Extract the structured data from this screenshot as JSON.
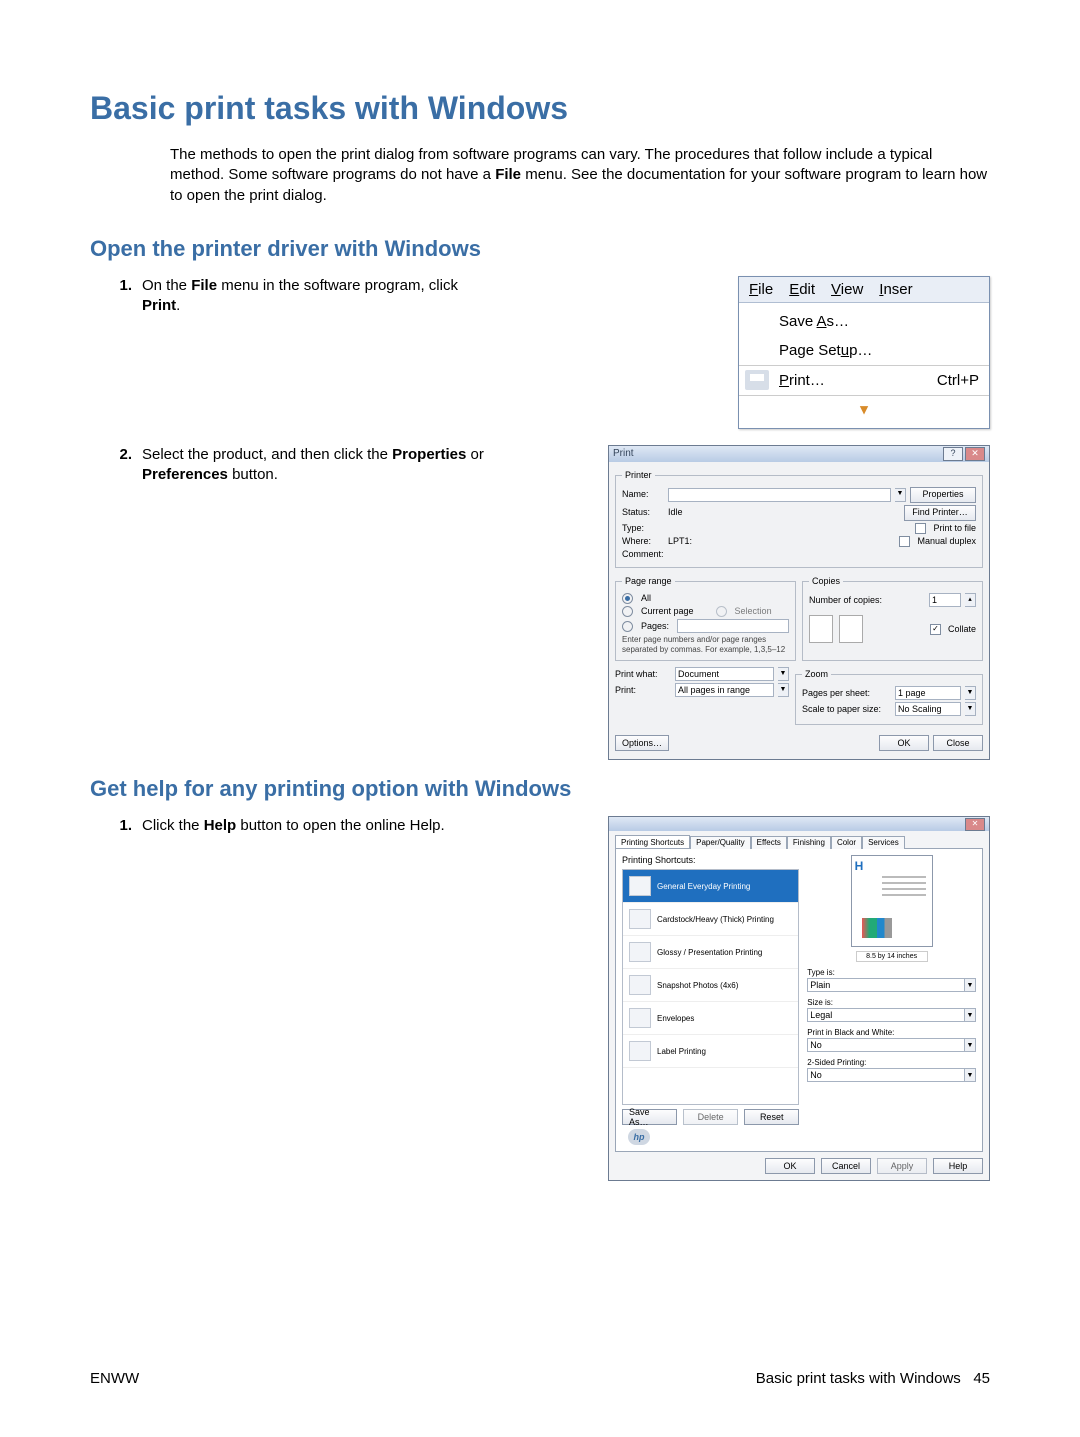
{
  "headings": {
    "h1": "Basic print tasks with Windows",
    "h2a": "Open the printer driver with Windows",
    "h2b": "Get help for any printing option with Windows"
  },
  "intro": "The methods to open the print dialog from software programs can vary. The procedures that follow include a typical method. Some software programs do not have a ",
  "intro_bold": "File",
  "intro_after": " menu. See the documentation for your software program to learn how to open the print dialog.",
  "steps": {
    "a1_pre": "On the ",
    "a1_b1": "File",
    "a1_mid": " menu in the software program, click ",
    "a1_b2": "Print",
    "a1_post": ".",
    "a2_pre": "Select the product, and then click the ",
    "a2_b1": "Properties",
    "a2_or": " or ",
    "a2_b2": "Preferences",
    "a2_post": " button.",
    "b1_pre": "Click the ",
    "b1_b1": "Help",
    "b1_post": " button to open the online Help."
  },
  "menu": {
    "file": "File",
    "edit": "Edit",
    "view": "View",
    "insert": "Inser",
    "save_as": "Save As…",
    "page_setup": "Page Setup…",
    "print": "Print…",
    "print_accel": "Ctrl+P",
    "chev": "▾"
  },
  "print_dlg": {
    "title": "Print",
    "printer_legend": "Printer",
    "name": "Name:",
    "status": "Status:",
    "status_v": "Idle",
    "type": "Type:",
    "where": "Where:",
    "where_v": "LPT1:",
    "comment": "Comment:",
    "properties": "Properties",
    "find_printer": "Find Printer…",
    "print_to_file": "Print to file",
    "manual_duplex": "Manual duplex",
    "page_range": "Page range",
    "all": "All",
    "current_page": "Current page",
    "selection": "Selection",
    "pages": "Pages:",
    "pages_hint": "Enter page numbers and/or page ranges separated by commas. For example, 1,3,5–12",
    "copies": "Copies",
    "num_copies": "Number of copies:",
    "num_copies_v": "1",
    "collate": "Collate",
    "print_what": "Print what:",
    "print_what_v": "Document",
    "print": "Print:",
    "print_v": "All pages in range",
    "zoom": "Zoom",
    "pps": "Pages per sheet:",
    "pps_v": "1 page",
    "scale": "Scale to paper size:",
    "scale_v": "No Scaling",
    "options": "Options…",
    "ok": "OK",
    "close": "Close"
  },
  "prop_dlg": {
    "tabs": [
      "Printing Shortcuts",
      "Paper/Quality",
      "Effects",
      "Finishing",
      "Color",
      "Services"
    ],
    "section_label": "Printing Shortcuts:",
    "shortcuts": [
      "General Everyday Printing",
      "Cardstock/Heavy (Thick) Printing",
      "Glossy / Presentation Printing",
      "Snapshot Photos (4x6)",
      "Envelopes",
      "Label Printing"
    ],
    "save_as": "Save As…",
    "delete": "Delete",
    "reset": "Reset",
    "dim": "8.5 by 14 inches",
    "type_is": "Type is:",
    "type_v": "Plain",
    "size_is": "Size is:",
    "size_v": "Legal",
    "bw": "Print in Black and White:",
    "bw_v": "No",
    "twosided": "2-Sided Printing:",
    "twosided_v": "No",
    "ok": "OK",
    "cancel": "Cancel",
    "apply": "Apply",
    "help": "Help",
    "hp": "H"
  },
  "footer": {
    "left": "ENWW",
    "right_text": "Basic print tasks with Windows",
    "right_page": "45"
  }
}
